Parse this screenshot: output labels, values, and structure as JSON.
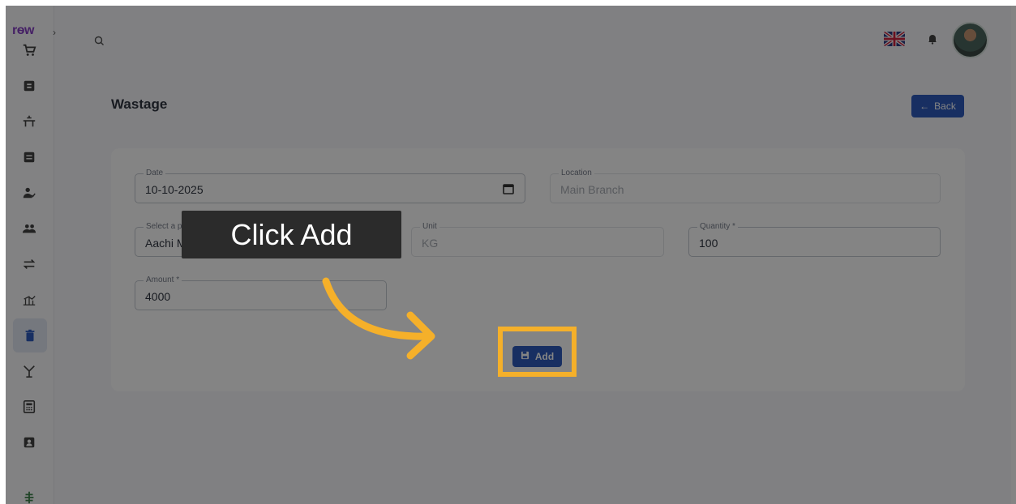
{
  "app": {
    "logo_text": "rѳw"
  },
  "sidebar": {
    "items": [
      {
        "name": "pos-cart"
      },
      {
        "name": "orders"
      },
      {
        "name": "table"
      },
      {
        "name": "inventory"
      },
      {
        "name": "staff"
      },
      {
        "name": "customers"
      },
      {
        "name": "transfer"
      },
      {
        "name": "reports"
      },
      {
        "name": "wastage",
        "active": true
      },
      {
        "name": "promotions"
      },
      {
        "name": "calculator"
      },
      {
        "name": "contacts"
      },
      {
        "name": "settings"
      }
    ]
  },
  "header": {
    "language": "EN",
    "notifications": true
  },
  "page": {
    "title": "Wastage",
    "back_label": "Back"
  },
  "form": {
    "date": {
      "label": "Date",
      "value": "10-10-2025"
    },
    "location": {
      "label": "Location",
      "value": "Main Branch"
    },
    "product": {
      "label": "Select a product",
      "value": "Aachi Murukku"
    },
    "unit": {
      "label": "Unit",
      "value": "KG"
    },
    "quantity": {
      "label": "Quantity *",
      "value": "100"
    },
    "amount": {
      "label": "Amount *",
      "value": "4000"
    },
    "add_label": "Add"
  },
  "tutorial": {
    "tooltip": "Click Add"
  },
  "colors": {
    "primary": "#1f4fb8",
    "highlight": "#f5b02a",
    "brand": "#7b2fbf"
  }
}
